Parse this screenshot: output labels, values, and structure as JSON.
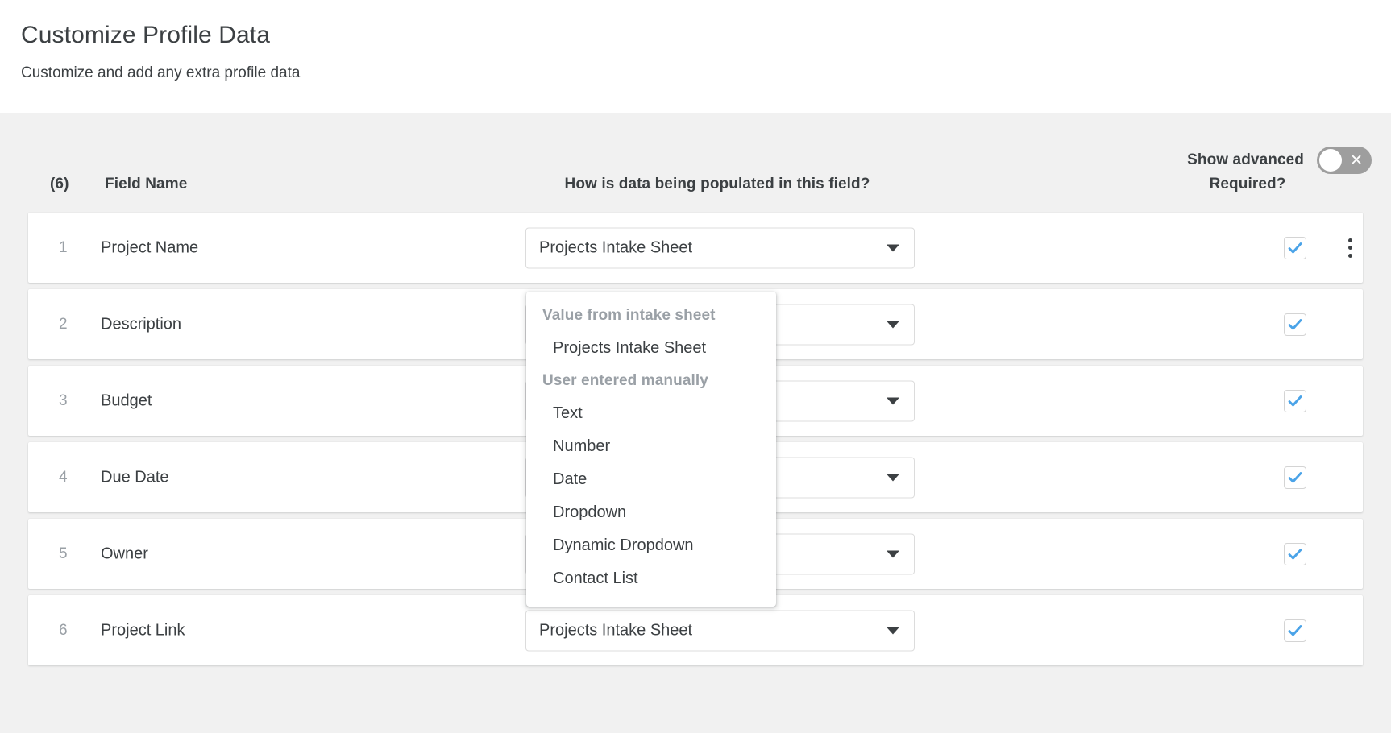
{
  "header": {
    "title": "Customize Profile Data",
    "subtitle": "Customize and add any extra profile data"
  },
  "toolbar": {
    "advanced_label": "Show advanced",
    "advanced_toggle_state": "off",
    "advanced_toggle_glyph": "✕"
  },
  "table": {
    "count_label": "(6)",
    "columns": {
      "field_name": "Field Name",
      "populated": "How is data being populated in this field?",
      "required": "Required?"
    },
    "rows": [
      {
        "index": "1",
        "field_name": "Project Name",
        "source": "Projects Intake Sheet",
        "required": true
      },
      {
        "index": "2",
        "field_name": "Description",
        "source": "",
        "required": true
      },
      {
        "index": "3",
        "field_name": "Budget",
        "source": "",
        "required": true
      },
      {
        "index": "4",
        "field_name": "Due Date",
        "source": "",
        "required": true
      },
      {
        "index": "5",
        "field_name": "Owner",
        "source": "",
        "required": true
      },
      {
        "index": "6",
        "field_name": "Project Link",
        "source": "Projects Intake Sheet",
        "required": true
      }
    ]
  },
  "dropdown_menu": {
    "open_for_row": "1",
    "groups": [
      {
        "label": "Value from intake sheet",
        "items": [
          "Projects Intake Sheet"
        ]
      },
      {
        "label": "User entered manually",
        "items": [
          "Text",
          "Number",
          "Date",
          "Dropdown",
          "Dynamic Dropdown",
          "Contact List"
        ]
      }
    ]
  },
  "colors": {
    "page_background": "#ffffff",
    "body_background": "#f1f1f1",
    "row_background": "#ffffff",
    "text_primary": "#3c4043",
    "text_muted": "#9aa0a6",
    "checkbox_check": "#4aa3e8",
    "toggle_track_off": "#9e9e9e",
    "select_border": "#dcdcdc"
  }
}
